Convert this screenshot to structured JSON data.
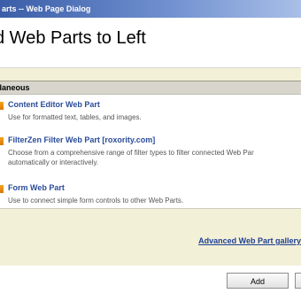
{
  "window": {
    "title": "arts -- Web Page Dialog"
  },
  "dialog": {
    "heading": "d Web Parts to Left"
  },
  "group": {
    "label": "llaneous"
  },
  "web_parts": [
    {
      "title": "Content Editor Web Part",
      "description": "Use for formatted text, tables, and images."
    },
    {
      "title": "FilterZen Filter Web Part [roxority.com]",
      "description_line1": "Choose from a comprehensive range of filter types to filter connected Web Par",
      "description_line2": "automatically or interactively."
    },
    {
      "title": "Form Web Part",
      "description": "Use to connect simple form controls to other Web Parts."
    }
  ],
  "links": {
    "gallery": "Advanced Web Part gallery"
  },
  "buttons": {
    "add": "Add",
    "second": ""
  },
  "colors": {
    "title_bar": "#3b5ea8",
    "panel_background": "#f3f0d8",
    "item_title": "#2a4c9a",
    "icon_orange": "#f6a41d"
  }
}
